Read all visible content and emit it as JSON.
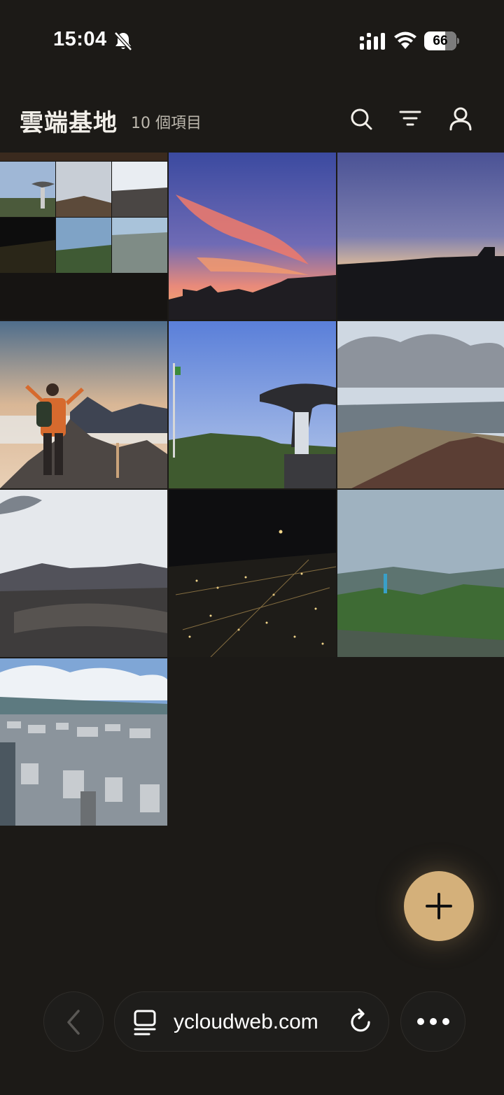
{
  "status_bar": {
    "time": "15:04",
    "battery_level": "66",
    "battery_fraction": 0.66,
    "icons": [
      "bell-off-icon",
      "cellular-signal-icon",
      "wifi-icon",
      "battery-icon"
    ]
  },
  "header": {
    "title": "雲端基地",
    "count": "10 個項目",
    "actions": [
      "search-icon",
      "filter-icon",
      "account-icon"
    ]
  },
  "gallery": {
    "items": [
      {
        "id": 1,
        "kind": "collage"
      },
      {
        "id": 2,
        "kind": "sunset-sky"
      },
      {
        "id": 3,
        "kind": "dusk-skyline"
      },
      {
        "id": 4,
        "kind": "hiker-on-summit"
      },
      {
        "id": 5,
        "kind": "sculpture-park"
      },
      {
        "id": 6,
        "kind": "mountain-ridge"
      },
      {
        "id": 7,
        "kind": "volcanic-crater"
      },
      {
        "id": 8,
        "kind": "city-lights-at-night"
      },
      {
        "id": 9,
        "kind": "green-valley-town"
      },
      {
        "id": 10,
        "kind": "city-aerial"
      }
    ]
  },
  "fab": {
    "icon": "plus-icon"
  },
  "browser_bar": {
    "url": "ycloudweb.com",
    "icons": [
      "back-chevron-icon",
      "page-icon",
      "reload-icon",
      "more-icon"
    ]
  },
  "colors": {
    "background": "#1c1a17",
    "accent": "#d4b07a",
    "text": "#f2efe9",
    "muted_text": "#bdb8ae"
  }
}
